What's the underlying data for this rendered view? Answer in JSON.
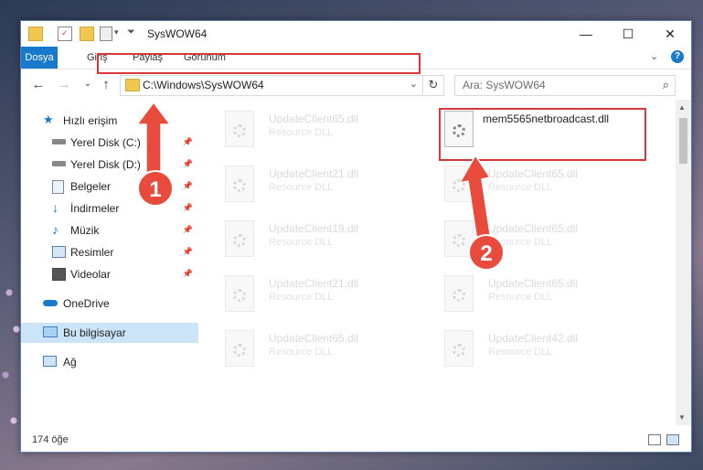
{
  "window": {
    "title": "SysWOW64",
    "controls": {
      "minimize": "—",
      "maximize": "☐",
      "close": "✕"
    }
  },
  "ribbon": {
    "tabs": [
      "Dosya",
      "Giriş",
      "Paylaş",
      "Görünüm"
    ],
    "expand": "⌄",
    "help": "?"
  },
  "nav": {
    "back": "←",
    "forward": "→",
    "recent": "⌄",
    "up": "↑",
    "address": "C:\\Windows\\SysWOW64",
    "address_chevron": "⌄",
    "refresh": "↻",
    "search_placeholder": "Ara: SysWOW64",
    "search_icon": "⌕"
  },
  "sidebar": {
    "items": [
      {
        "label": "Hızlı erişim",
        "icon": "star-icon",
        "pinned": false
      },
      {
        "label": "Yerel Disk (C:)",
        "icon": "drive-icon",
        "pinned": true
      },
      {
        "label": "Yerel Disk (D:)",
        "icon": "drive-icon",
        "pinned": true
      },
      {
        "label": "Belgeler",
        "icon": "documents-icon",
        "pinned": true
      },
      {
        "label": "İndirmeler",
        "icon": "download-icon",
        "pinned": true
      },
      {
        "label": "Müzik",
        "icon": "music-icon",
        "pinned": true
      },
      {
        "label": "Resimler",
        "icon": "pictures-icon",
        "pinned": true
      },
      {
        "label": "Videolar",
        "icon": "videos-icon",
        "pinned": true
      },
      {
        "label": "OneDrive",
        "icon": "cloud-icon",
        "pinned": false
      },
      {
        "label": "Bu bilgisayar",
        "icon": "computer-icon",
        "pinned": false,
        "selected": true
      },
      {
        "label": "Ağ",
        "icon": "network-icon",
        "pinned": false
      }
    ],
    "pin_glyph": "📌"
  },
  "files": [
    {
      "name": "UpdateClient65.dll",
      "type": "Resource DLL"
    },
    {
      "name": "mem5565netbroadcast.dll",
      "type": "",
      "selected": true
    },
    {
      "name": "UpdateClient21.dll",
      "type": "Resource DLL"
    },
    {
      "name": "UpdateClient65.dll",
      "type": "Resource DLL"
    },
    {
      "name": "UpdateClient19.dll",
      "type": "Resource DLL"
    },
    {
      "name": "UpdateClient65.dll",
      "type": "Resource DLL"
    },
    {
      "name": "UpdateClient21.dll",
      "type": "Resource DLL"
    },
    {
      "name": "UpdateClient65.dll",
      "type": "Resource DLL"
    },
    {
      "name": "UpdateClient65.dll",
      "type": "Resource DLL"
    },
    {
      "name": "UpdateClient42.dll",
      "type": "Resource DLL"
    }
  ],
  "status": {
    "count": "174 öğe"
  },
  "annotations": {
    "step1": "1",
    "step2": "2",
    "color": "#e84a3c"
  }
}
